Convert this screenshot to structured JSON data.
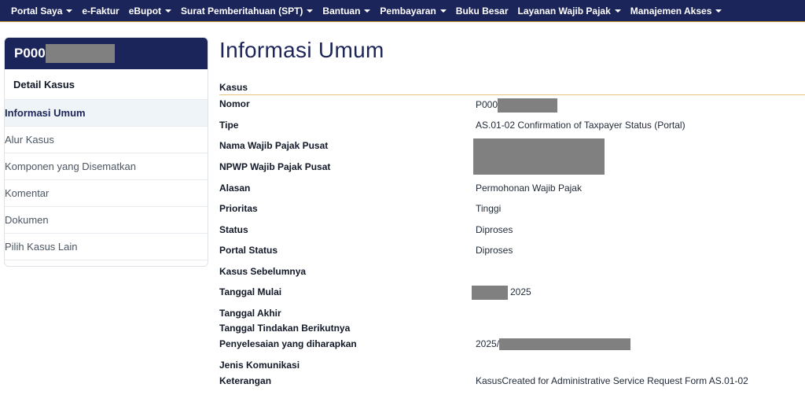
{
  "topnav": {
    "items": [
      {
        "label": "Portal Saya",
        "dropdown": true
      },
      {
        "label": "e-Faktur",
        "dropdown": false
      },
      {
        "label": "eBupot",
        "dropdown": true
      },
      {
        "label": "Surat Pemberitahuan (SPT)",
        "dropdown": true
      },
      {
        "label": "Bantuan",
        "dropdown": true
      },
      {
        "label": "Pembayaran",
        "dropdown": true
      },
      {
        "label": "Buku Besar",
        "dropdown": false
      },
      {
        "label": "Layanan Wajib Pajak",
        "dropdown": true
      },
      {
        "label": "Manajemen Akses",
        "dropdown": true
      }
    ]
  },
  "sidebar": {
    "case_prefix": "P000",
    "detail_title": "Detail Kasus",
    "items": [
      {
        "label": "Informasi Umum",
        "active": true
      },
      {
        "label": "Alur Kasus",
        "active": false
      },
      {
        "label": "Komponen yang Disematkan",
        "active": false
      },
      {
        "label": "Komentar",
        "active": false
      },
      {
        "label": "Dokumen",
        "active": false
      },
      {
        "label": "Pilih Kasus Lain",
        "active": false
      }
    ]
  },
  "main": {
    "title": "Informasi Umum",
    "section": "Kasus",
    "fields": {
      "nomor": {
        "label": "Nomor",
        "value": "P000"
      },
      "tipe": {
        "label": "Tipe",
        "value": "AS.01-02 Confirmation of Taxpayer Status (Portal)"
      },
      "nama": {
        "label": "Nama Wajib Pajak Pusat",
        "value": ""
      },
      "npwp": {
        "label": "NPWP Wajib Pajak Pusat",
        "value": ""
      },
      "alasan": {
        "label": "Alasan",
        "value": "Permohonan Wajib Pajak"
      },
      "prioritas": {
        "label": "Prioritas",
        "value": "Tinggi"
      },
      "status": {
        "label": "Status",
        "value": "Diproses"
      },
      "portal_status": {
        "label": "Portal Status",
        "value": "Diproses"
      },
      "kasus_sebelumnya": {
        "label": "Kasus Sebelumnya",
        "value": ""
      },
      "tanggal_mulai": {
        "label": "Tanggal Mulai",
        "value": "2025"
      },
      "tanggal_akhir": {
        "label": "Tanggal Akhir",
        "value": ""
      },
      "tanggal_tindakan": {
        "label": "Tanggal Tindakan Berikutnya",
        "value": ""
      },
      "penyelesaian": {
        "label": "Penyelesaian yang diharapkan",
        "value": "2025/"
      },
      "jenis_komunikasi": {
        "label": "Jenis Komunikasi",
        "value": ""
      },
      "keterangan": {
        "label": "Keterangan",
        "value": "KasusCreated for Administrative Service Request Form AS.01-02"
      }
    }
  },
  "colors": {
    "navy": "#1c2559",
    "accent_line": "#e8c27a",
    "redaction": "#808080"
  }
}
